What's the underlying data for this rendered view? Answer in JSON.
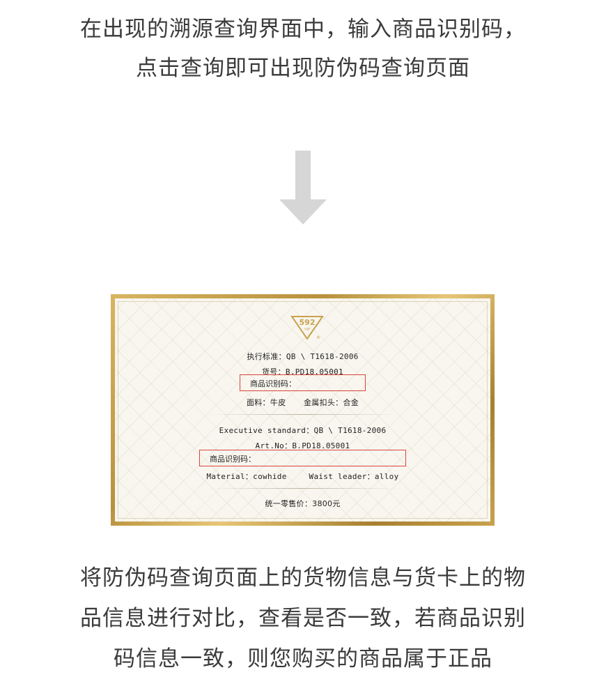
{
  "intro": {
    "line1": "在出现的溯源查询界面中，输入商品识别码，",
    "line2": "点击查询即可出现防伪码查询页面"
  },
  "arrow": {
    "icon": "down-arrow-icon",
    "color": "#d6d6d6"
  },
  "card": {
    "logo": {
      "text": "592",
      "sub": "VIP",
      "reg": "®",
      "color": "#c9a24f"
    },
    "cn": {
      "standard": "执行标准：QB \\ T1618-2006",
      "item_no": "货号：B.PD18.05001",
      "code_label": "商品识别码：",
      "material": "面料：牛皮",
      "buckle": "金属扣头：合金"
    },
    "en": {
      "standard": "Executive standard：QB \\ T1618-2006",
      "art_no": "Art.No：B.PD18.05001",
      "code_label": "商品识别码：",
      "material": "Material：cowhide",
      "leader": "Waist leader：alloy"
    },
    "price": "统一零售价：3800元",
    "highlight_color": "#d9443b"
  },
  "outro": {
    "line1": "将防伪码查询页面上的货物信息与货卡上的物",
    "line2": "品信息进行对比，查看是否一致，若商品识别",
    "line3": "码信息一致，则您购买的商品属于正品"
  }
}
